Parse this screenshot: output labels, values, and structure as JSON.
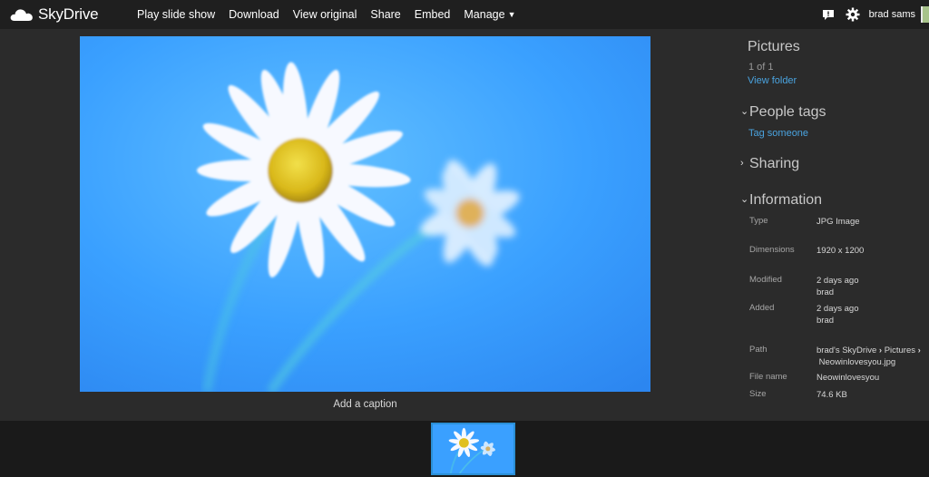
{
  "brand": {
    "name": "SkyDrive"
  },
  "toolbar": {
    "play": "Play slide show",
    "download": "Download",
    "view_original": "View original",
    "share": "Share",
    "embed": "Embed",
    "manage": "Manage"
  },
  "user": {
    "name": "brad sams"
  },
  "caption": {
    "placeholder": "Add a caption"
  },
  "panel": {
    "folder": {
      "title": "Pictures",
      "count": "1 of 1",
      "link": "View folder"
    },
    "people_tags": {
      "title": "People tags",
      "link": "Tag someone",
      "expanded": true
    },
    "sharing": {
      "title": "Sharing",
      "expanded": false
    },
    "information": {
      "title": "Information",
      "expanded": true,
      "type_label": "Type",
      "type_value": "JPG Image",
      "dimensions_label": "Dimensions",
      "dimensions_value": "1920 x 1200",
      "modified_label": "Modified",
      "modified_when": "2 days ago",
      "modified_by": "brad",
      "added_label": "Added",
      "added_when": "2 days ago",
      "added_by": "brad",
      "path_label": "Path",
      "path_root": "brad's SkyDrive",
      "path_folder": "Pictures",
      "path_file": "Neowinlovesyou.jpg",
      "filename_label": "File name",
      "filename_value": "Neowinlovesyou",
      "size_label": "Size",
      "size_value": "74.6 KB"
    }
  },
  "colors": {
    "topbar": "#1f1f1f",
    "background": "#2b2b2b",
    "link": "#4aa3df",
    "thumb_border": "#2a8fd6",
    "photo_sky": "#3aa0ff"
  },
  "icons": {
    "logo": "cloud-icon",
    "feedback": "feedback-icon",
    "settings": "gear-icon",
    "expand": "chevron-down-icon",
    "collapse": "chevron-right-icon"
  }
}
